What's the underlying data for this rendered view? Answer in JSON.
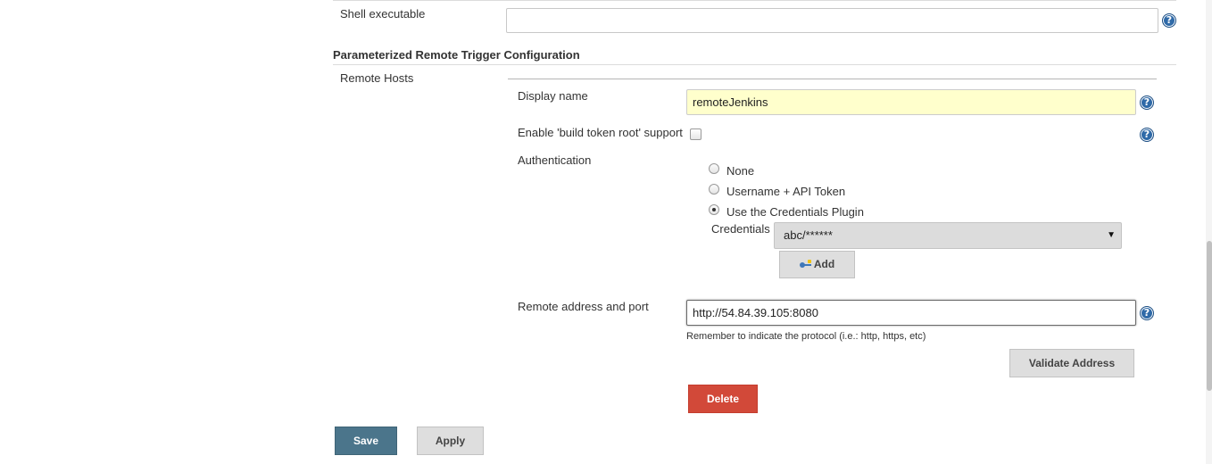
{
  "shell": {
    "label": "Shell executable",
    "value": ""
  },
  "section": {
    "title": "Parameterized Remote Trigger Configuration",
    "remote_hosts_label": "Remote Hosts"
  },
  "host": {
    "display_name_label": "Display name",
    "display_name_value": "remoteJenkins",
    "build_token_label": "Enable 'build token root' support",
    "build_token_checked": false,
    "auth_label": "Authentication",
    "auth_options": [
      "None",
      "Username + API Token",
      "Use the Credentials Plugin"
    ],
    "auth_selected": "Use the Credentials Plugin",
    "credentials_label": "Credentials",
    "credentials_value": "abc/******",
    "add_label": "Add",
    "address_label": "Remote address and port",
    "address_value": "http://54.84.39.105:8080",
    "address_hint": "Remember to indicate the protocol (i.e.: http, https, etc)",
    "validate_label": "Validate Address",
    "delete_label": "Delete"
  },
  "footer": {
    "save_label": "Save",
    "apply_label": "Apply"
  },
  "icons": {
    "help": "help-icon",
    "key": "key-icon",
    "dropdown": "dropdown-arrow-icon"
  },
  "colors": {
    "save_button": "#4b758b",
    "delete_button": "#d24939",
    "help_icon": "#2f6aa8",
    "highlight_field": "#ffffcc"
  }
}
